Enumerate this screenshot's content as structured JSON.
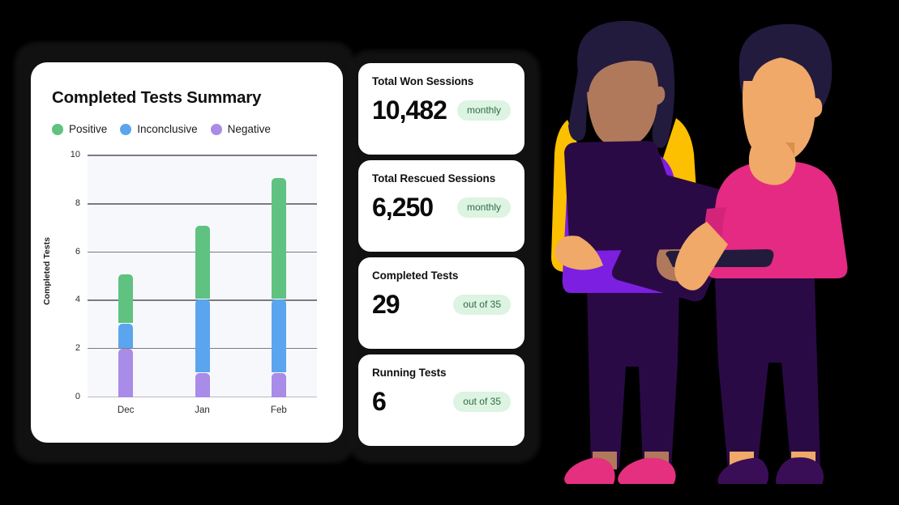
{
  "chart_card": {
    "title": "Completed Tests Summary",
    "legend": [
      {
        "label": "Positive",
        "color": "#5FC280",
        "icon": "legend-dot-positive"
      },
      {
        "label": "Inconclusive",
        "color": "#5BA5EE",
        "icon": "legend-dot-inconclusive"
      },
      {
        "label": "Negative",
        "color": "#A98BE8",
        "icon": "legend-dot-negative"
      }
    ]
  },
  "chart_data": {
    "type": "bar",
    "subtype": "stacked",
    "title": "Completed Tests Summary",
    "xlabel": "",
    "ylabel": "Completed Tests",
    "categories": [
      "Dec",
      "Jan",
      "Feb"
    ],
    "series": [
      {
        "name": "Negative",
        "color": "#A98BE8",
        "values": [
          2,
          1,
          1
        ]
      },
      {
        "name": "Inconclusive",
        "color": "#5BA5EE",
        "values": [
          1,
          3,
          3
        ]
      },
      {
        "name": "Positive",
        "color": "#5FC280",
        "values": [
          2,
          3,
          5
        ]
      }
    ],
    "totals": [
      5,
      7,
      9
    ],
    "ylim": [
      0,
      10
    ],
    "yticks": [
      0,
      2,
      4,
      6,
      8,
      10
    ],
    "grid": true,
    "legend_position": "top-left",
    "plot_background": "#F7F8FB"
  },
  "stats": [
    {
      "label": "Total Won Sessions",
      "value": "10,482",
      "badge": "monthly"
    },
    {
      "label": "Total Rescued Sessions",
      "value": "6,250",
      "badge": "monthly"
    },
    {
      "label": "Completed Tests",
      "value": "29",
      "badge": "out of 35"
    },
    {
      "label": "Running Tests",
      "value": "6",
      "badge": "out of 35"
    }
  ],
  "illustration": {
    "name": "two-people-with-devices-illustration",
    "figures": [
      {
        "name": "woman-with-tablet",
        "hair": "#221B3E",
        "skin": "#B0795C",
        "vest": "#7D1FE0",
        "sleeve": "#FCC000",
        "pants": "#2A0A45",
        "shoes": "#E5307F",
        "device": "tablet-with-stylus",
        "device_color": "#2A0A45"
      },
      {
        "name": "man-with-laptop",
        "hair": "#221B3E",
        "skin": "#F0A968",
        "shirt": "#E42A82",
        "pants": "#2A0A45",
        "shoes": "#3A0E56",
        "device": "open-laptop",
        "device_color": "#2A0A45"
      }
    ]
  },
  "colors": {
    "background": "#000000",
    "card": "#FFFFFF",
    "badge_bg": "#DCF4E1",
    "badge_text": "#2F6B4B",
    "grid": "#7B7B83"
  }
}
